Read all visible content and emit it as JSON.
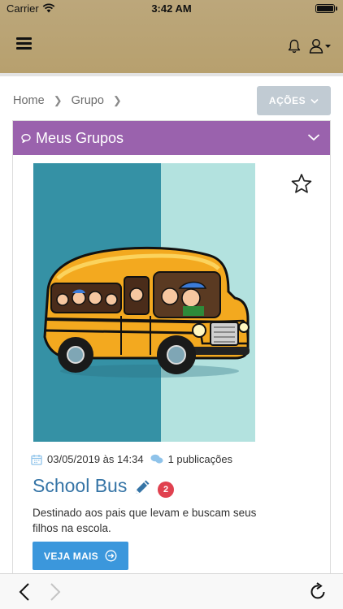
{
  "status_bar": {
    "carrier": "Carrier",
    "time": "3:42 AM"
  },
  "app_bar": {
    "icons": [
      "menu-icon",
      "bell-icon",
      "user-icon"
    ]
  },
  "breadcrumb": {
    "items": [
      "Home",
      "Grupo"
    ]
  },
  "actions_button": {
    "label": "AÇÕES"
  },
  "panel": {
    "title": "Meus Grupos"
  },
  "group": {
    "date": "03/05/2019 às 14:34",
    "posts": "1 publicações",
    "title": "School Bus",
    "badge": "2",
    "description": "Destinado aos pais que levam e buscam seus filhos na escola.",
    "button_label": "VEJA MAIS"
  },
  "colors": {
    "header": "#b9a371",
    "panel_header": "#9a62ad",
    "link": "#3574a6",
    "button": "#3b97dc",
    "badge": "#e0414f",
    "actions_button": "#c1cbd3"
  },
  "toolbar": {
    "icons": [
      "back-icon",
      "forward-icon",
      "reload-icon"
    ]
  }
}
